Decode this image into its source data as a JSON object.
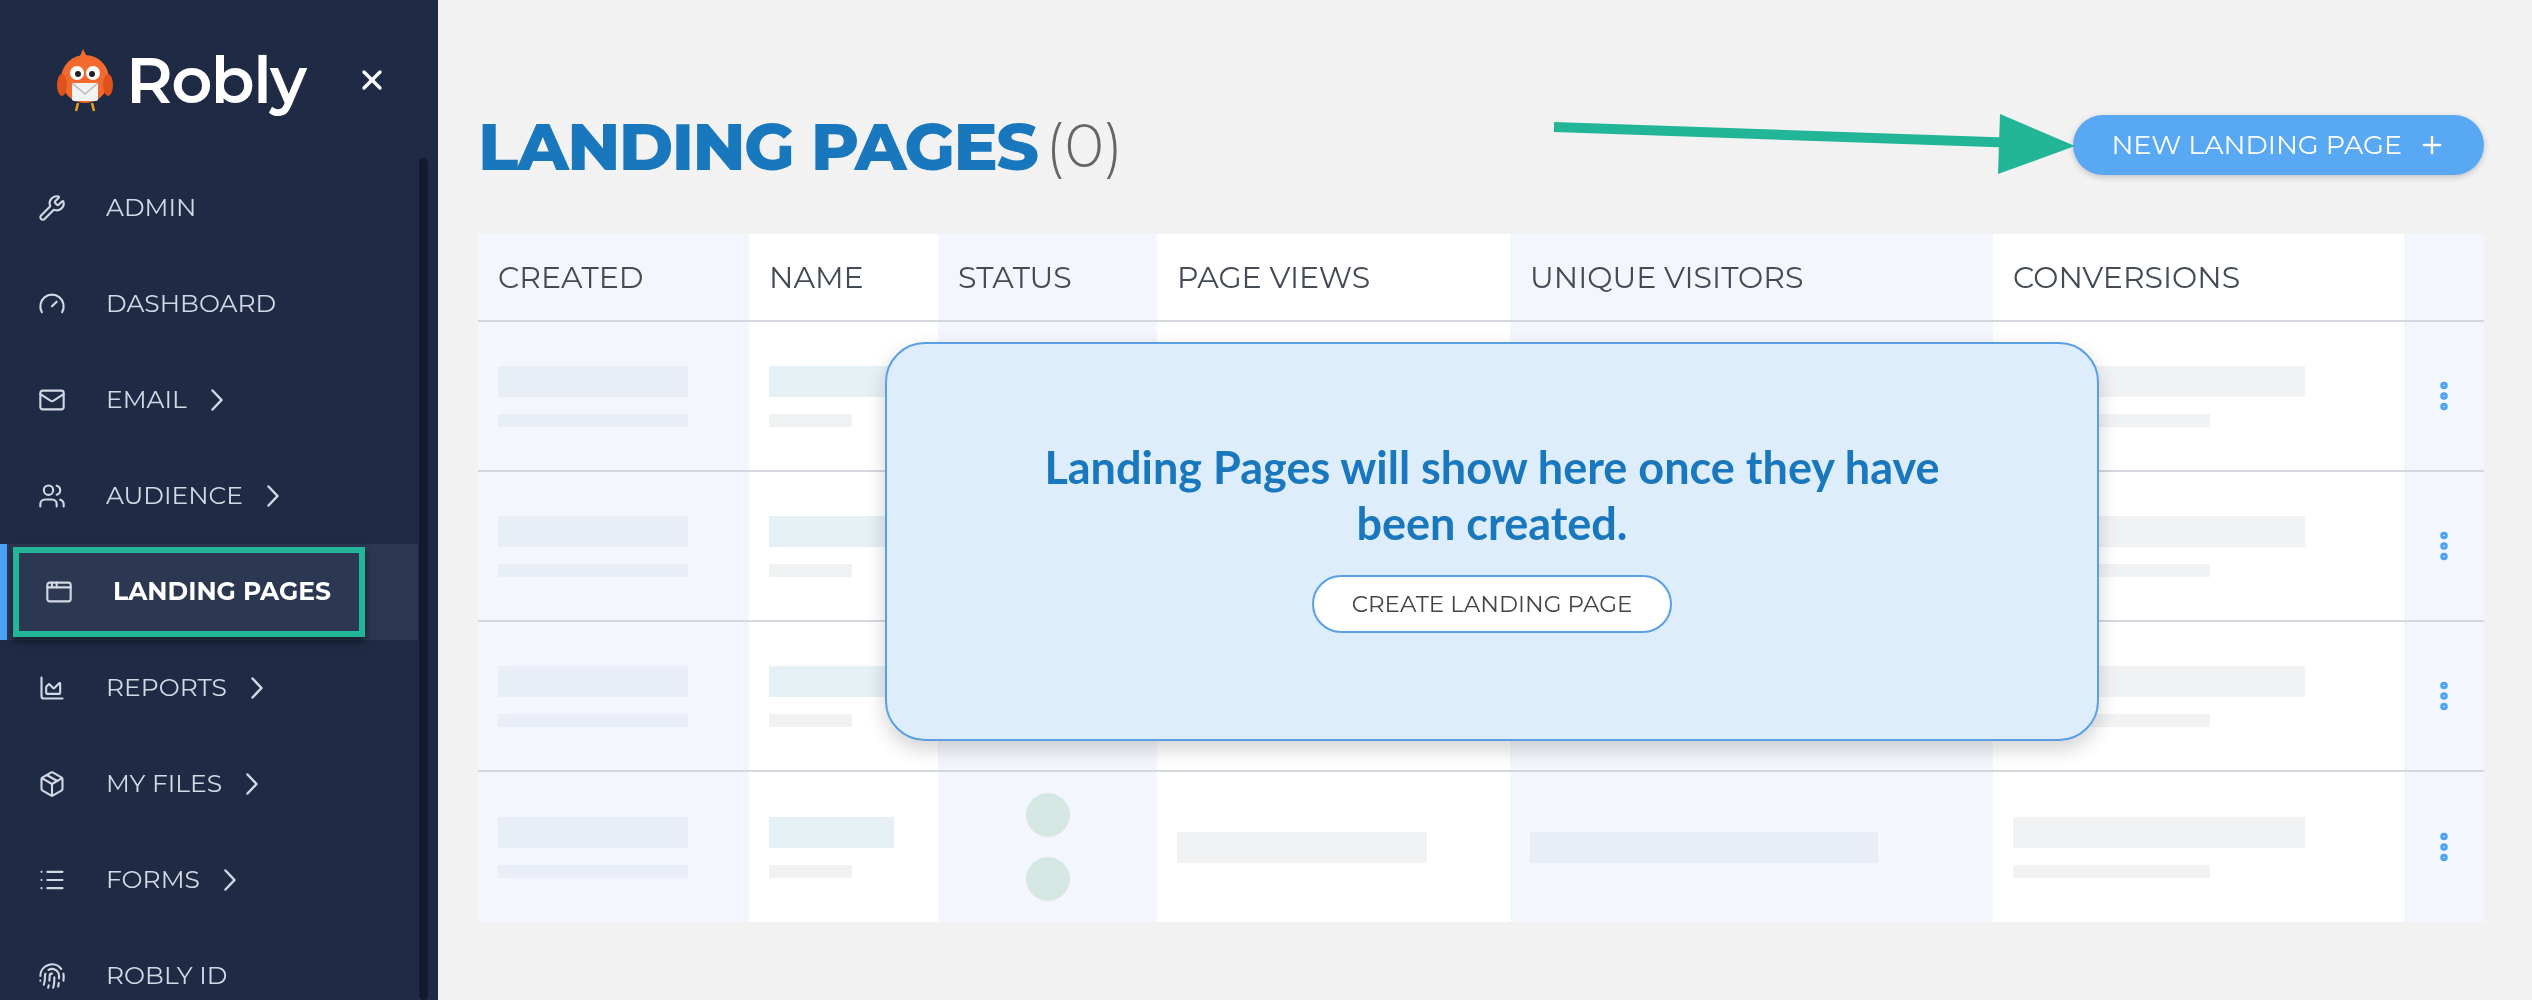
{
  "sidebar": {
    "brand": "Robly",
    "items": [
      {
        "label": "ADMIN",
        "has_submenu": false,
        "selected": false
      },
      {
        "label": "DASHBOARD",
        "has_submenu": false,
        "selected": false
      },
      {
        "label": "EMAIL",
        "has_submenu": true,
        "selected": false
      },
      {
        "label": "AUDIENCE",
        "has_submenu": true,
        "selected": false
      },
      {
        "label": "LANDING PAGES",
        "has_submenu": false,
        "selected": true
      },
      {
        "label": "REPORTS",
        "has_submenu": true,
        "selected": false
      },
      {
        "label": "MY FILES",
        "has_submenu": true,
        "selected": false
      },
      {
        "label": "FORMS",
        "has_submenu": true,
        "selected": false
      },
      {
        "label": "ROBLY ID",
        "has_submenu": false,
        "selected": false
      }
    ]
  },
  "page": {
    "title": "LANDING PAGES",
    "count": "(0)",
    "new_button": "NEW LANDING PAGE"
  },
  "table": {
    "columns": [
      "CREATED",
      "NAME",
      "STATUS",
      "PAGE VIEWS",
      "UNIQUE VISITORS",
      "CONVERSIONS"
    ],
    "rows": [
      {
        "kind": "covered"
      },
      {
        "kind": "covered"
      },
      {
        "kind": "covered"
      },
      {
        "kind": "skeleton"
      }
    ]
  },
  "empty_state": {
    "message": "Landing Pages will show here once they have been created.",
    "button": "CREATE LANDING PAGE"
  }
}
